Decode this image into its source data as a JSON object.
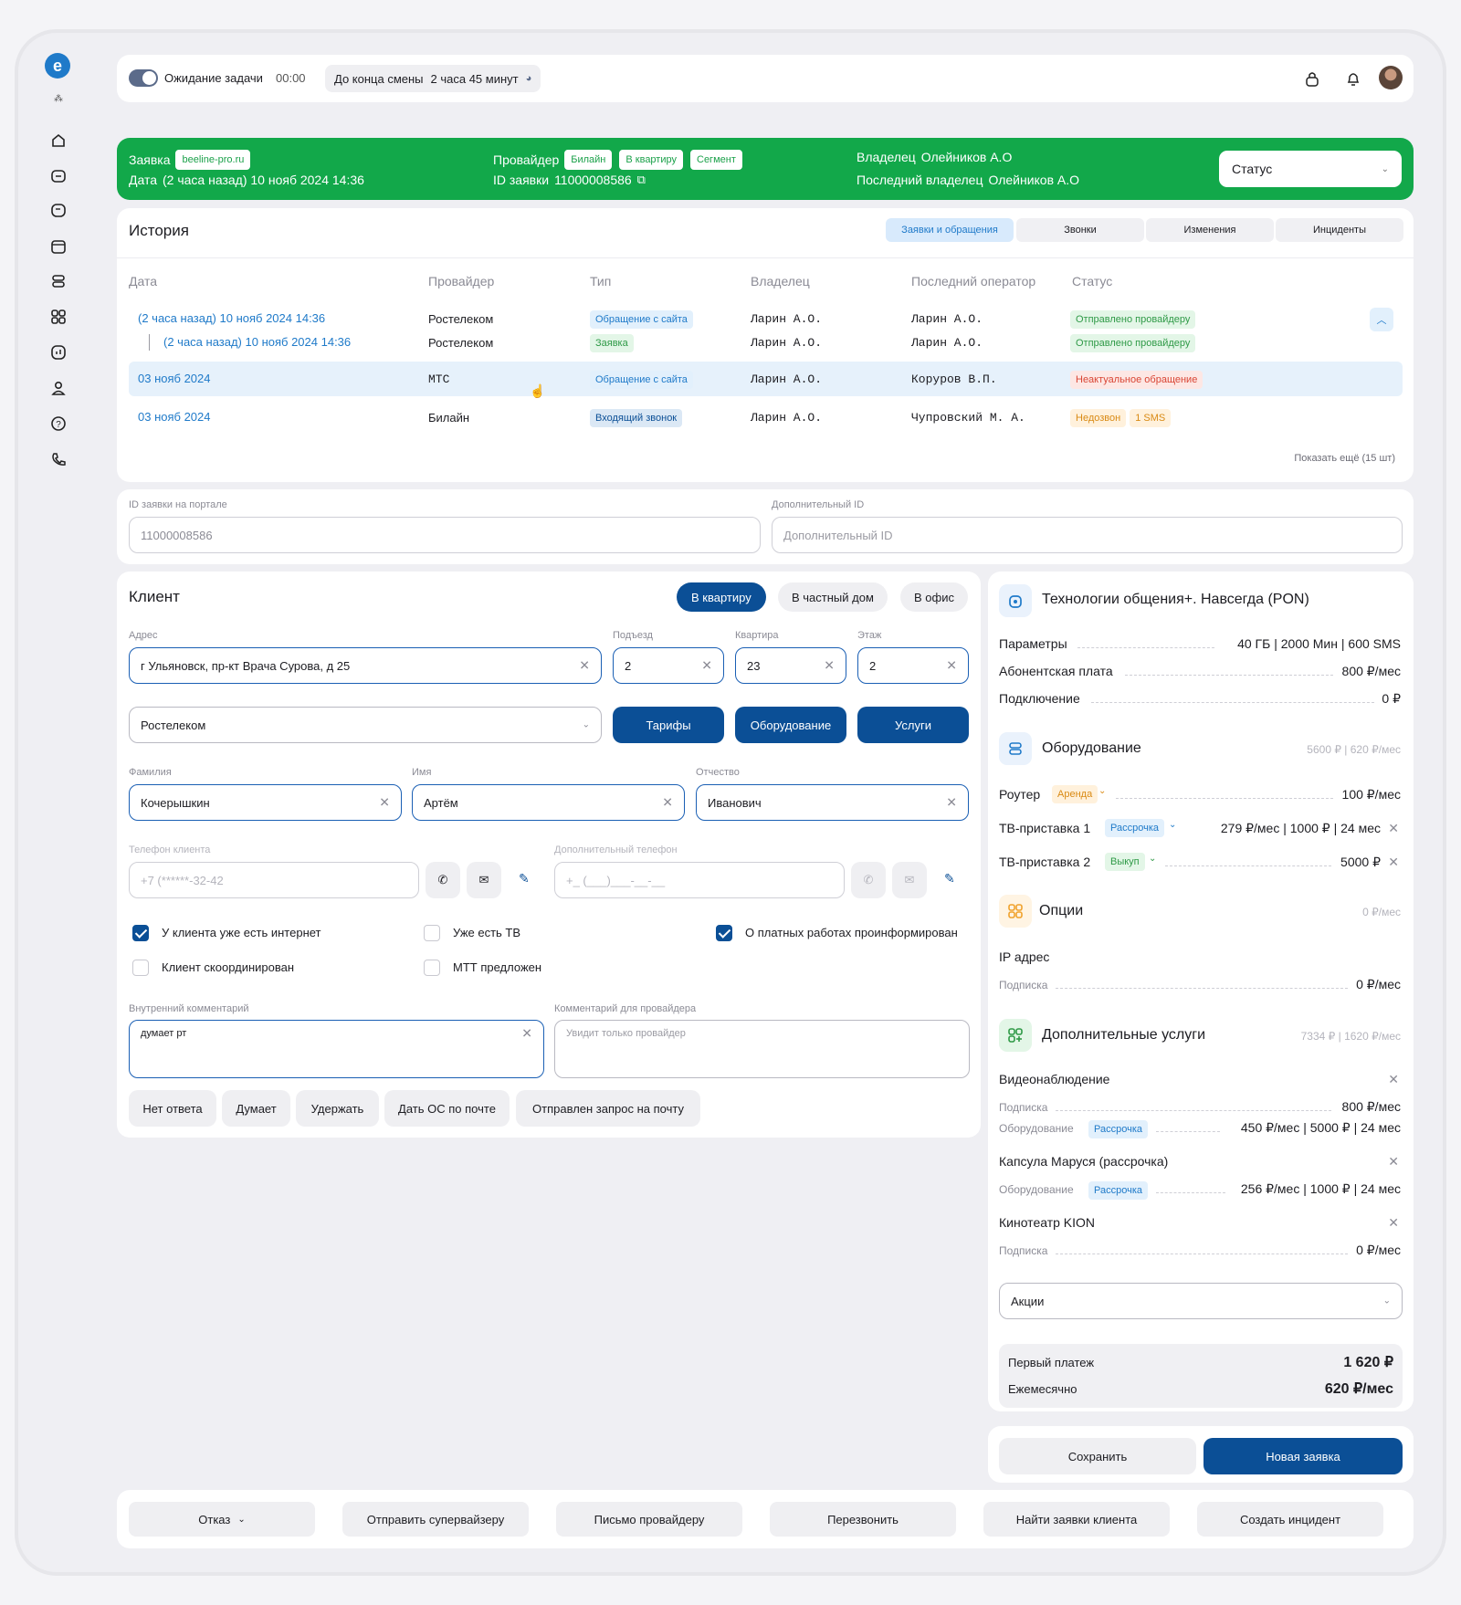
{
  "topbar": {
    "toggle_label": "Ожидание задачи",
    "timer": "00:00",
    "shift_label": "До конца смены",
    "shift_value": "2 часа 45 минут"
  },
  "banner": {
    "request_label": "Заявка",
    "request_source": "beeline-pro.ru",
    "date_label": "Дата",
    "date_value": "(2 часа назад) 10 нояб 2024 14:36",
    "provider_label": "Провайдер",
    "provider_tags": [
      "Билайн",
      "В квартиру",
      "Сегмент"
    ],
    "id_label": "ID заявки",
    "id_value": "11000008586",
    "owner_label": "Владелец",
    "owner_value": "Олейников А.О",
    "last_owner_label": "Последний владелец",
    "last_owner_value": "Олейников А.О",
    "status_select": "Статус"
  },
  "history": {
    "title": "История",
    "tabs": [
      "Заявки и обращения",
      "Звонки",
      "Изменения",
      "Инциденты"
    ],
    "columns": [
      "Дата",
      "Провайдер",
      "Тип",
      "Владелец",
      "Последний оператор",
      "Статус"
    ],
    "rows": [
      {
        "date": "(2 часа назад) 10 нояб 2024 14:36",
        "provider": "Ростелеком",
        "type": "Обращение с сайта",
        "owner": "Ларин А.О.",
        "operator": "Ларин А.О.",
        "status": "Отправлено провайдеру"
      },
      {
        "date": "(2 часа назад) 10 нояб 2024 14:36",
        "provider": "Ростелеком",
        "type": "Заявка",
        "owner": "Ларин А.О.",
        "operator": "Ларин А.О.",
        "status": "Отправлено провайдеру"
      },
      {
        "date": "03 нояб 2024",
        "provider": "МТС",
        "type": "Обращение с сайта",
        "owner": "Ларин А.О.",
        "operator": "Коруров В.П.",
        "status": "Неактуальное обращение"
      },
      {
        "date": "03 нояб 2024",
        "provider": "Билайн",
        "type": "Входящий звонок",
        "owner": "Ларин А.О.",
        "operator": "Чупровский М. А.",
        "status": "Недозвон",
        "status2": "1 SMS"
      }
    ],
    "show_more": "Показать ещё (15 шт)"
  },
  "ids": {
    "portal_label": "ID заявки на портале",
    "portal_value": "11000008586",
    "extra_label": "Дополнительный ID",
    "extra_placeholder": "Дополнительный ID"
  },
  "client": {
    "title": "Клиент",
    "segments": [
      "В квартиру",
      "В частный дом",
      "В офис"
    ],
    "address_label": "Адрес",
    "address": "г Ульяновск, пр-кт Врача Сурова, д 25",
    "entrance_label": "Подъезд",
    "entrance": "2",
    "apt_label": "Квартира",
    "apt": "23",
    "floor_label": "Этаж",
    "floor": "2",
    "provider": "Ростелеком",
    "btn_tariffs": "Тарифы",
    "btn_equipment": "Оборудование",
    "btn_services": "Услуги",
    "last_label": "Фамилия",
    "last": "Кочерышкин",
    "first_label": "Имя",
    "first": "Артём",
    "middle_label": "Отчество",
    "middle": "Иванович",
    "phone_label": "Телефон клиента",
    "phone_placeholder": "+7 (******-32-42",
    "phone2_label": "Дополнительный телефон",
    "phone2_placeholder": "+_ (___)___-__-__",
    "checks": [
      {
        "label": "У клиента уже есть интернет",
        "on": true
      },
      {
        "label": "Уже есть ТВ",
        "on": false
      },
      {
        "label": "О платных работах проинформирован",
        "on": true
      },
      {
        "label": "Клиент скоординирован",
        "on": false
      },
      {
        "label": "МТТ предложен",
        "on": false
      }
    ],
    "inner_label": "Внутренний комментарий",
    "inner_value": "думает рт",
    "prov_label": "Комментарий для провайдера",
    "prov_placeholder": "Увидит только провайдер",
    "quick": [
      "Нет ответа",
      "Думает",
      "Удержать",
      "Дать ОС по почте",
      "Отправлен запрос на почту"
    ]
  },
  "tariff": {
    "title": "Технологии общения+. Навсегда (PON)",
    "params": [
      {
        "k": "Параметры",
        "v": "40 ГБ | 2000 Мин | 600 SMS"
      },
      {
        "k": "Абонентская плата",
        "v": "800 ₽/мес"
      },
      {
        "k": "Подключение",
        "v": "0 ₽"
      }
    ],
    "equipment_title": "Оборудование",
    "equipment_sum": "5600 ₽ | 620 ₽/мес",
    "equipment": [
      {
        "k": "Роутер",
        "tag": "Аренда",
        "v": "100 ₽/мес"
      },
      {
        "k": "ТВ-приставка 1",
        "tag": "Рассрочка",
        "v": "279 ₽/мес | 1000 ₽ | 24 мес"
      },
      {
        "k": "ТВ-приставка 2",
        "tag": "Выкуп",
        "v": "5000 ₽"
      }
    ],
    "options_title": "Опции",
    "options_sum": "0 ₽/мес",
    "ip_title": "IP адрес",
    "ip_sub": "Подписка",
    "ip_val": "0 ₽/мес",
    "extra_title": "Дополнительные услуги",
    "extra_sum": "7334 ₽ | 1620 ₽/мес",
    "cctv": "Видеонаблюдение",
    "cctv_sub": "Подписка",
    "cctv_sub_v": "800 ₽/мес",
    "cctv_eq": "Оборудование",
    "cctv_tag": "Рассрочка",
    "cctv_eq_v": "450 ₽/мес | 5000 ₽ | 24 мес",
    "marusya": "Капсула Маруся (рассрочка)",
    "marusya_eq": "Оборудование",
    "marusya_tag": "Рассрочка",
    "marusya_v": "256 ₽/мес | 1000 ₽ | 24 мес",
    "kion": "Кинотеатр KION",
    "kion_sub": "Подписка",
    "kion_v": "0 ₽/мес",
    "promo": "Акции",
    "first_pay_label": "Первый платеж",
    "first_pay": "1 620 ₽",
    "monthly_label": "Ежемесячно",
    "monthly": "620 ₽/мес"
  },
  "actions": {
    "save": "Сохранить",
    "new": "Новая заявка"
  },
  "bottom": [
    "Отказ",
    "Отправить супервайзеру",
    "Письмо провайдеру",
    "Перезвонить",
    "Найти заявки клиента",
    "Создать инцидент"
  ],
  "colors": {
    "accent": "#0b4f96",
    "banner": "#12a84a",
    "link": "#1f7ac9"
  }
}
